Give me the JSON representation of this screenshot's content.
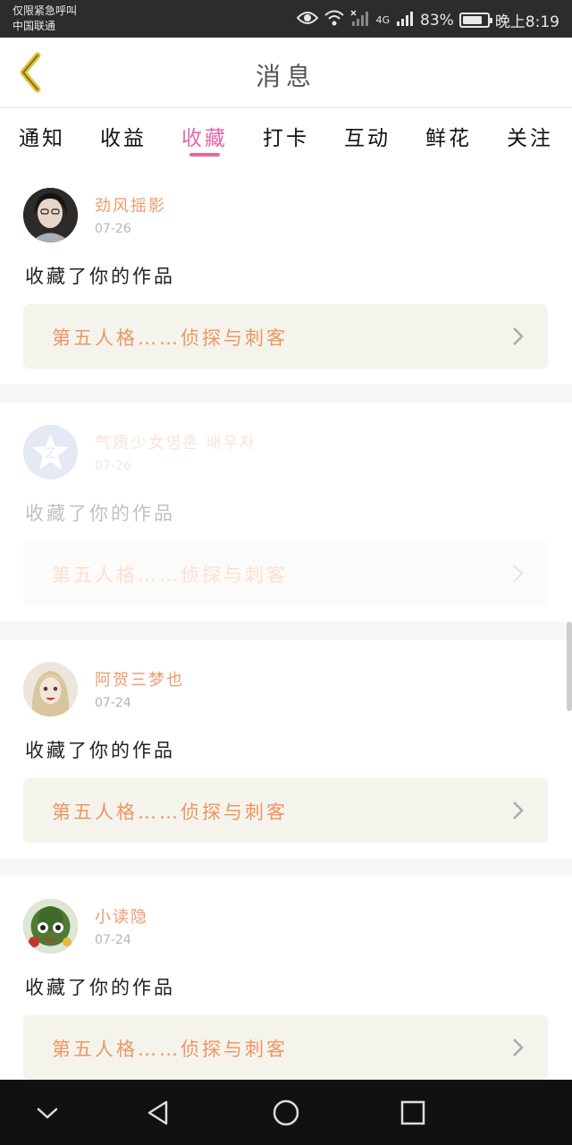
{
  "status_bar": {
    "line1": "仅限紧急呼叫",
    "line2": "中国联通",
    "network": "4G",
    "battery": "83%",
    "battery_level": 0.83,
    "time": "晚上8:19"
  },
  "header": {
    "title": "消息",
    "back_icon": "chevron-left-icon"
  },
  "tabs": [
    {
      "label": "通知",
      "active": false
    },
    {
      "label": "收益",
      "active": false
    },
    {
      "label": "收藏",
      "active": true
    },
    {
      "label": "打卡",
      "active": false
    },
    {
      "label": "互动",
      "active": false
    },
    {
      "label": "鲜花",
      "active": false
    },
    {
      "label": "关注",
      "active": false
    }
  ],
  "items": [
    {
      "username": "劲风摇影",
      "date": "07-26",
      "action": "收藏了你的作品",
      "work": "第五人格……侦探与刺客"
    },
    {
      "username": "气质少女영혼 배우자",
      "date": "07-26",
      "action": "收藏了你的作品",
      "work": "第五人格……侦探与刺客"
    },
    {
      "username": "阿贺三梦也",
      "date": "07-24",
      "action": "收藏了你的作品",
      "work": "第五人格……侦探与刺客"
    },
    {
      "username": "小读隐",
      "date": "07-24",
      "action": "收藏了你的作品",
      "work": "第五人格……侦探与刺客"
    }
  ],
  "colors": {
    "accent": "#e069a6",
    "username": "#ee9b6c",
    "card_bg": "#f4f4ec",
    "card_text": "#ef9563"
  }
}
